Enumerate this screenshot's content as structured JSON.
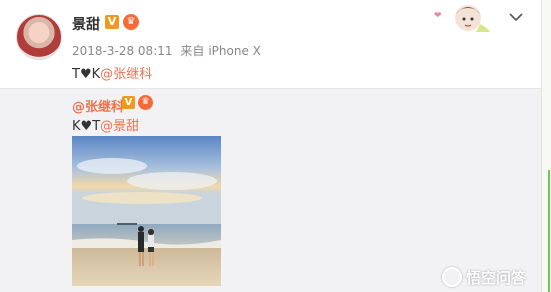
{
  "post": {
    "author": "景甜",
    "vip_badge": "V",
    "crown_badge": "♛",
    "timestamp": "2018-3-28 08:11",
    "source_prefix": "来自",
    "source_device": "iPhone X",
    "text_prefix": "T",
    "text_heart": "♥",
    "text_mid": "K",
    "mention": "@张继科"
  },
  "repost": {
    "author": "@张继科",
    "vip_badge": "V",
    "crown_badge": "♛",
    "text_prefix": "K",
    "text_heart": "♥",
    "text_mid": "T",
    "mention": "@景甜"
  },
  "watermark": {
    "label": "悟空问答"
  },
  "icons": {
    "chevron": "chevron-down-icon",
    "decoration": "sticker-decoration",
    "watermark": "wukong-logo-icon"
  },
  "colors": {
    "mention": "#eb7350",
    "vip": "#f09a1c",
    "repost_bg": "#f2f2f5",
    "accent_green": "#6ccb4a"
  }
}
